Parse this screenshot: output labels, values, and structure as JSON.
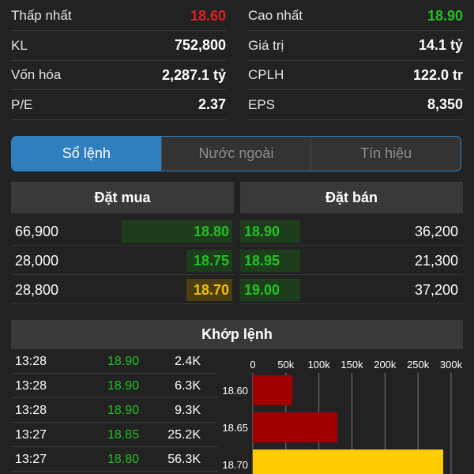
{
  "stats": [
    {
      "label": "Thấp nhất",
      "value": "18.60",
      "color": "#e02020"
    },
    {
      "label": "Cao nhất",
      "value": "18.90",
      "color": "#22c022"
    },
    {
      "label": "KL",
      "value": "752,800",
      "color": "#ffffff"
    },
    {
      "label": "Giá trị",
      "value": "14.1 tỷ",
      "color": "#ffffff"
    },
    {
      "label": "Vốn hóa",
      "value": "2,287.1 tỷ",
      "color": "#ffffff"
    },
    {
      "label": "CPLH",
      "value": "122.0 tr",
      "color": "#ffffff"
    },
    {
      "label": "P/E",
      "value": "2.37",
      "color": "#ffffff"
    },
    {
      "label": "EPS",
      "value": "8,350",
      "color": "#ffffff"
    }
  ],
  "tabs": [
    {
      "label": "Sổ lệnh",
      "active": true
    },
    {
      "label": "Nước ngoài",
      "active": false
    },
    {
      "label": "Tín hiệu",
      "active": false
    }
  ],
  "orderbook": {
    "buy_header": "Đặt mua",
    "sell_header": "Đặt bán",
    "rows": [
      {
        "buy_vol": "66,900",
        "buy_price": "18.80",
        "buy_color": "#22c022",
        "buy_bg": "#1d3d1d",
        "sell_price": "18.90",
        "sell_color": "#22c022",
        "sell_bg": "#1d3d1d",
        "sell_vol": "36,200"
      },
      {
        "buy_vol": "28,000",
        "buy_price": "18.75",
        "buy_color": "#22c022",
        "buy_bg": "#1d3d1d",
        "sell_price": "18.95",
        "sell_color": "#22c022",
        "sell_bg": "#1d3d1d",
        "sell_vol": "21,300"
      },
      {
        "buy_vol": "28,800",
        "buy_price": "18.70",
        "buy_color": "#f2c000",
        "buy_bg": "#4a3e12",
        "sell_price": "19.00",
        "sell_color": "#22c022",
        "sell_bg": "#1d3d1d",
        "sell_vol": "37,200"
      }
    ]
  },
  "matched": {
    "header": "Khớp lệnh",
    "trades": [
      {
        "time": "13:28",
        "price": "18.90",
        "volume": "2.4K"
      },
      {
        "time": "13:28",
        "price": "18.90",
        "volume": "6.3K"
      },
      {
        "time": "13:28",
        "price": "18.90",
        "volume": "9.3K"
      },
      {
        "time": "13:27",
        "price": "18.85",
        "volume": "25.2K"
      },
      {
        "time": "13:27",
        "price": "18.80",
        "volume": "56.3K"
      }
    ],
    "trade_price_color": "#22c022"
  },
  "chart_data": {
    "type": "bar",
    "orientation": "horizontal",
    "categories": [
      "18.60",
      "18.65",
      "18.70"
    ],
    "values": [
      60000,
      128000,
      288000
    ],
    "bar_colors": [
      "#a00000",
      "#a00000",
      "#ffcc00"
    ],
    "xlim": [
      0,
      300000
    ],
    "x_ticks": [
      0,
      50000,
      100000,
      150000,
      200000,
      250000,
      300000
    ],
    "x_tick_labels": [
      "0",
      "50k",
      "100k",
      "150k",
      "200k",
      "250k",
      "300k"
    ],
    "grid": true
  }
}
